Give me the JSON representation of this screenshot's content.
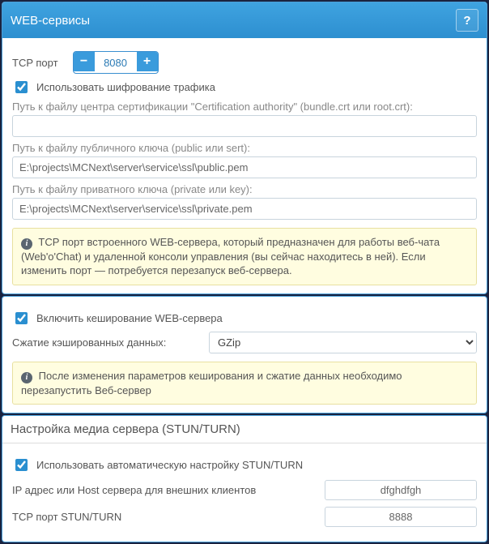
{
  "web": {
    "title": "WEB-сервисы",
    "tcp_port_label": "TCP порт",
    "tcp_port_value": "8080",
    "encrypt_label": "Использовать шифрование трафика",
    "ca_label": "Путь к файлу центра сертификации \"Certification authority\" (bundle.crt или root.crt):",
    "ca_value": "",
    "pub_label": "Путь к файлу публичного ключа (public или sert):",
    "pub_value": "E:\\projects\\MCNext\\server\\service\\ssl\\public.pem",
    "priv_label": "Путь к файлу приватного ключа (private или key):",
    "priv_value": "E:\\projects\\MCNext\\server\\service\\ssl\\private.pem",
    "note1": "TCP порт встроенного WEB-сервера, который предназначен для работы веб-чата (Web'o'Chat) и удаленной консоли управления (вы сейчас находитесь в ней). Если изменить порт — потребуется перезапуск веб-сервера.",
    "cache_label": "Включить кеширование WEB-сервера",
    "compress_label": "Сжатие кэшированных данных:",
    "compress_value": "GZip",
    "note2": "После изменения параметров кеширования и сжатие данных необходимо перезапустить Веб-сервер"
  },
  "media": {
    "title": "Настройка медиа сервера (STUN/TURN)",
    "auto_label": "Использовать автоматическую настройку STUN/TURN",
    "host_label": "IP адрес или Host сервера для внешних клиентов",
    "host_value": "dfghdfgh",
    "port_label": "TCP порт STUN/TURN",
    "port_value": "8888"
  }
}
